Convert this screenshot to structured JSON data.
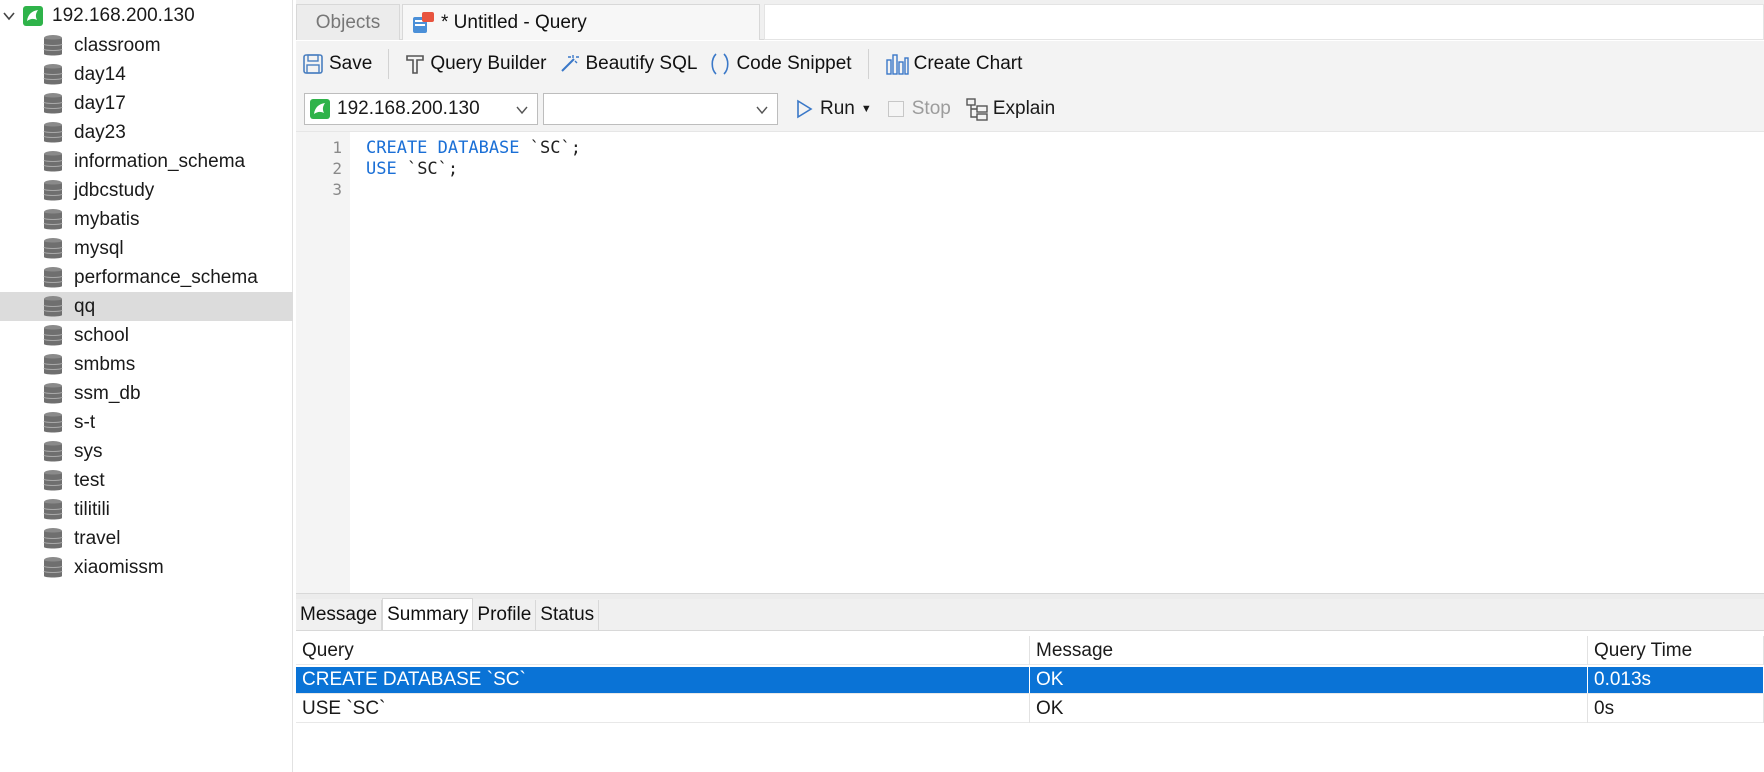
{
  "sidebar": {
    "connection": "192.168.200.130",
    "databases": [
      "classroom",
      "day14",
      "day17",
      "day23",
      "information_schema",
      "jdbcstudy",
      "mybatis",
      "mysql",
      "performance_schema",
      "qq",
      "school",
      "smbms",
      "ssm_db",
      "s-t",
      "sys",
      "test",
      "tilitili",
      "travel",
      "xiaomissm"
    ],
    "selected": "qq"
  },
  "tabs": {
    "objects": "Objects",
    "query": "* Untitled - Query"
  },
  "toolbar": {
    "save": "Save",
    "query_builder": "Query Builder",
    "beautify": "Beautify SQL",
    "snippet": "Code Snippet",
    "chart": "Create Chart"
  },
  "runbar": {
    "connection": "192.168.200.130",
    "database": "",
    "run": "Run",
    "stop": "Stop",
    "explain": "Explain"
  },
  "editor": {
    "lines": [
      {
        "no": "1",
        "kw": "CREATE DATABASE",
        "rest": " `SC`;"
      },
      {
        "no": "2",
        "kw": "USE",
        "rest": " `SC`;"
      },
      {
        "no": "3",
        "kw": "",
        "rest": ""
      }
    ]
  },
  "results": {
    "tabs": [
      "Message",
      "Summary",
      "Profile",
      "Status"
    ],
    "active_tab": "Summary",
    "columns": [
      "Query",
      "Message",
      "Query Time"
    ],
    "rows": [
      [
        "CREATE DATABASE `SC`",
        "OK",
        "0.013s"
      ],
      [
        "USE `SC`",
        "OK",
        "0s"
      ]
    ]
  },
  "colors": {
    "accent": "#0a73d6",
    "keyword": "#1a6fd6",
    "connection_green": "#2fb34a"
  }
}
